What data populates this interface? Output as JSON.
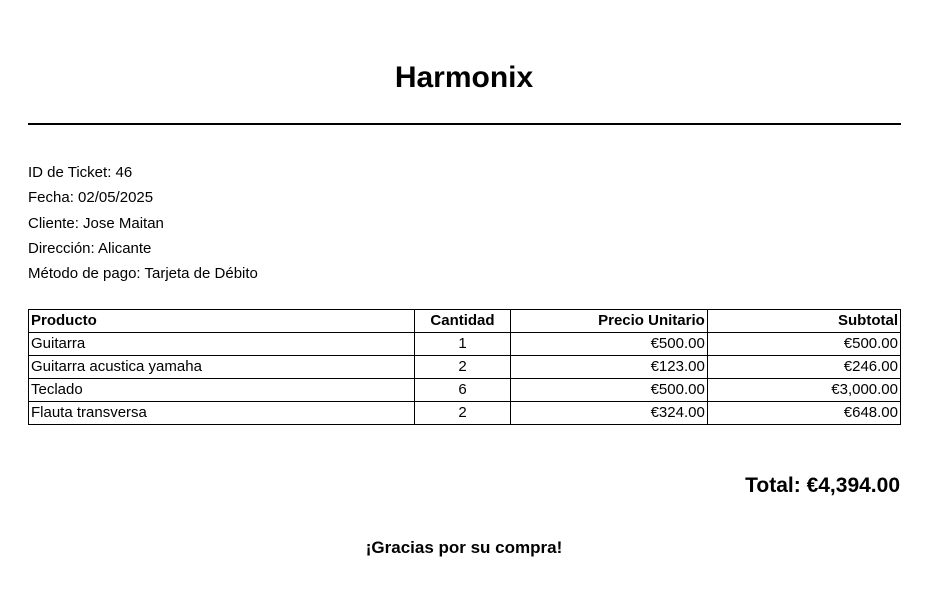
{
  "store": {
    "name": "Harmonix"
  },
  "ticket": {
    "id_line": "ID de Ticket: 46",
    "date_line": "Fecha: 02/05/2025",
    "client_line": "Cliente: Jose Maitan",
    "address_line": "Dirección: Alicante",
    "payment_line": "Método de pago: Tarjeta de Débito"
  },
  "table": {
    "headers": [
      "Producto",
      "Cantidad",
      "Precio Unitario",
      "Subtotal"
    ],
    "rows": [
      [
        "Guitarra",
        "1",
        "€500.00",
        "€500.00"
      ],
      [
        "Guitarra acustica yamaha",
        "2",
        "€123.00",
        "€246.00"
      ],
      [
        "Teclado",
        "6",
        "€500.00",
        "€3,000.00"
      ],
      [
        "Flauta transversa",
        "2",
        "€324.00",
        "€648.00"
      ]
    ]
  },
  "summary": {
    "total_line": "Total: €4,394.00",
    "thanks": "¡Gracias por su compra!"
  }
}
